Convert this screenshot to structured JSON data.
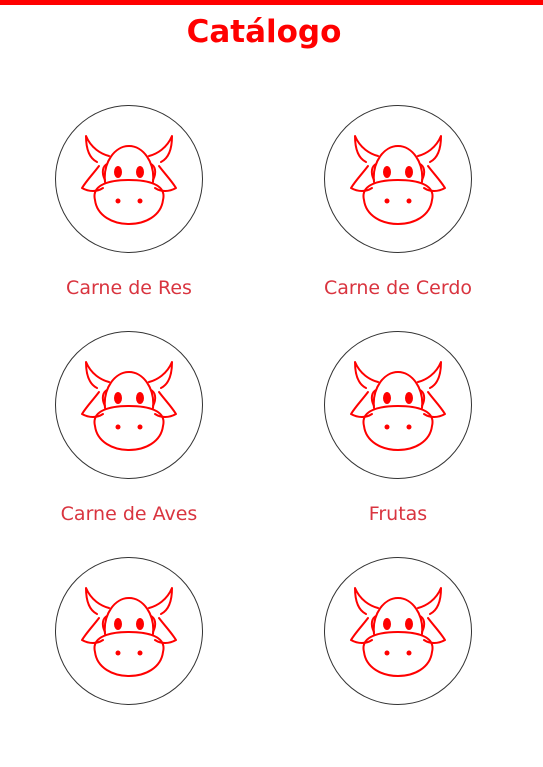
{
  "header": {
    "title": "Catálogo"
  },
  "catalog": {
    "items": [
      {
        "label": "Carne de Res",
        "icon": "cow-icon"
      },
      {
        "label": "Carne de Cerdo",
        "icon": "cow-icon"
      },
      {
        "label": "Carne de Aves",
        "icon": "cow-icon"
      },
      {
        "label": "Frutas",
        "icon": "cow-icon"
      },
      {
        "label": "",
        "icon": "cow-icon"
      },
      {
        "label": "",
        "icon": "cow-icon"
      }
    ]
  },
  "colors": {
    "accent": "#ff0000",
    "label": "#d9343f",
    "circle_border": "#333333"
  }
}
